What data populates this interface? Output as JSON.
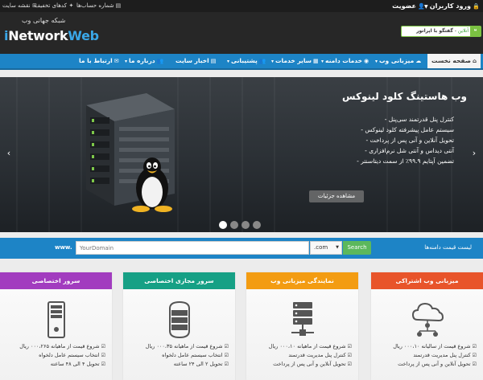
{
  "topbar": {
    "login": "ورود کاربران",
    "join": "عضویت",
    "accounts": "شماره حساب‌ها",
    "discounts": "کدهای تخفیف",
    "sitemap": "نقشه سایت"
  },
  "header": {
    "tagline": "شبکه جهانی وب",
    "logo_i": "i",
    "logo_network": "Network",
    "logo_web": "Web",
    "chat_text": "گفتگو با اپراتور",
    "chat_status": "آنلاین",
    "chat_separator": " - "
  },
  "nav": {
    "home": "صفحه نخست",
    "items": [
      "میزبانی وب",
      "خدمات دامنه",
      "سایر خدمات",
      "پشتیبانی",
      "اخبار سایت",
      "درباره ما",
      "ارتباط با ما"
    ]
  },
  "slider": {
    "title": "وب هاستینگ کلود لینوکس",
    "features": [
      "- کنترل پنل قدرتمند سی‌پنل",
      "- سیستم عامل پیشرفته کلود لینوکس",
      "- تحویل آنلاین و آنی پس از پرداخت",
      "- آنتی دیداس و آنتی شل نرم‌افزاری",
      "- تضمین آپتایم ۹۹.۹٪ از سمت دیتاسنتر"
    ],
    "button": "مشاهده جزئیات",
    "prev": "‹",
    "next": "›",
    "slide_count": 4,
    "active_slide": 1
  },
  "domain": {
    "label": "لیست قیمت دامنه‌ها",
    "prefix": "www.",
    "placeholder": "YourDomain",
    "tld": ".com",
    "search": "Search"
  },
  "colors": {
    "nav_blue": "#1d84c6",
    "card_red": "#e8542a",
    "card_orange": "#f39c12",
    "card_green": "#16a085",
    "card_purple": "#a23cbf"
  },
  "cards": [
    {
      "title": "میزبانی وب اشتراکی",
      "icon": "cloud-network-icon",
      "features": [
        "شروع قیمت از سالیانه ۰۰۰،۱۰ ریال",
        "کنترل پنل مدیریت قدرتمند",
        "تحویل آنلاین و آنی پس از پرداخت"
      ]
    },
    {
      "title": "نمایندگی میزبانی وب",
      "icon": "server-network-icon",
      "features": [
        "شروع قیمت از ماهیانه ۰۰۰،۱۰ ریال",
        "کنترل پنل مدیریت قدرتمند",
        "تحویل آنلاین و آنی پس از پرداخت"
      ]
    },
    {
      "title": "سرور مجازی اختصاصی",
      "icon": "server-rack-icon",
      "features": [
        "شروع قیمت از ماهیانه ۰۰۰،۳۵ ریال",
        "انتخاب سیستم عامل دلخواه",
        "تحویل ۲ الی ۲۴ ساعته"
      ]
    },
    {
      "title": "سرور اختصاصی",
      "icon": "server-tower-icon",
      "features": [
        "شروع قیمت از ماهیانه ۰۰۰،۲۶۵ ریال",
        "انتخاب سیستم عامل دلخواه",
        "تحویل ۴ الی ۴۸ ساعته"
      ]
    }
  ]
}
